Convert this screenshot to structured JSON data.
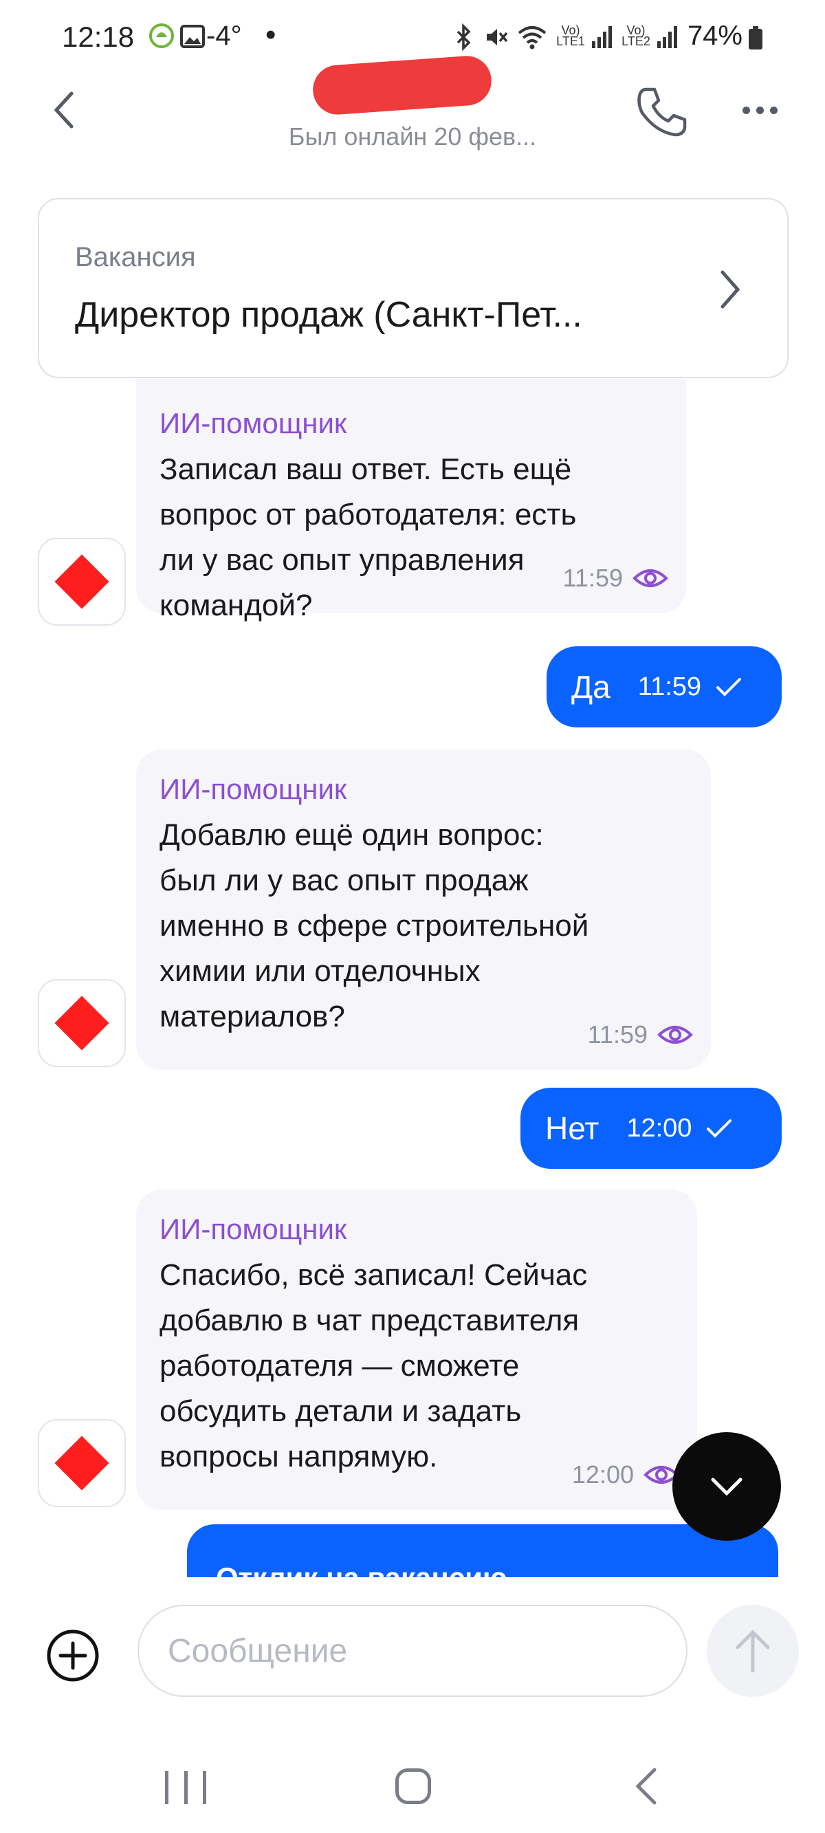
{
  "status_bar": {
    "time": "12:18",
    "temperature": "-4°",
    "dot": "•",
    "sim1_label": "Vo) LTE1",
    "sim2_label": "Vo) LTE2",
    "battery": "74%"
  },
  "header": {
    "status": "Был онлайн 20 фев..."
  },
  "vacancy": {
    "label": "Вакансия",
    "title": "Директор продаж (Санкт-Пет..."
  },
  "messages": [
    {
      "sender": "ИИ-помощник",
      "lines": [
        "Записал ваш ответ. Есть ещё",
        "вопрос от работодателя: есть",
        "ли у вас опыт управления",
        "командой?"
      ],
      "time": "11:59"
    },
    {
      "text": "Да",
      "time": "11:59"
    },
    {
      "sender": "ИИ-помощник",
      "lines": [
        "Добавлю ещё один вопрос:",
        "был ли у вас опыт продаж",
        "именно в сфере строительной",
        "химии или отделочных",
        "материалов?"
      ],
      "time": "11:59"
    },
    {
      "text": "Нет",
      "time": "12:00"
    },
    {
      "sender": "ИИ-помощник",
      "lines": [
        "Спасибо, всё записал! Сейчас",
        "добавлю в чат представителя",
        "работодателя — сможете",
        "обсудить детали и задать",
        "вопросы напрямую."
      ],
      "time": "12:00"
    }
  ],
  "apply_card": {
    "title": "Отклик на вакансию"
  },
  "composer": {
    "placeholder": "Сообщение"
  },
  "colors": {
    "accent": "#0a63ff",
    "sender": "#8d4fd3",
    "avatar_diamond": "#ff1e1e",
    "redaction": "#ef3b3b"
  }
}
